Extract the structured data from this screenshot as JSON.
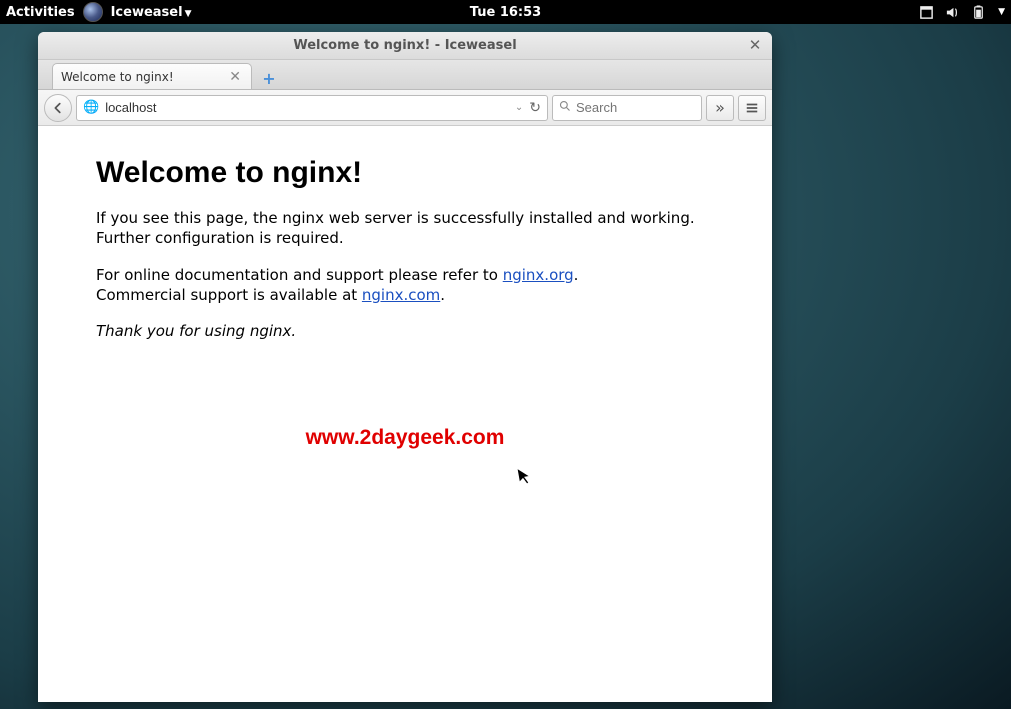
{
  "panel": {
    "activities": "Activities",
    "app_name": "Iceweasel",
    "clock": "Tue 16:53"
  },
  "window": {
    "title": "Welcome to nginx! - Iceweasel"
  },
  "tab": {
    "title": "Welcome to nginx!"
  },
  "urlbar": {
    "value": "localhost"
  },
  "search": {
    "placeholder": "Search"
  },
  "page": {
    "heading": "Welcome to nginx!",
    "p1": "If you see this page, the nginx web server is successfully installed and working. Further configuration is required.",
    "p2a": "For online documentation and support please refer to ",
    "link1": "nginx.org",
    "p2b": ".",
    "p2c": "Commercial support is available at ",
    "link2": "nginx.com",
    "p2d": ".",
    "thanks": "Thank you for using nginx."
  },
  "watermark": "www.2daygeek.com"
}
